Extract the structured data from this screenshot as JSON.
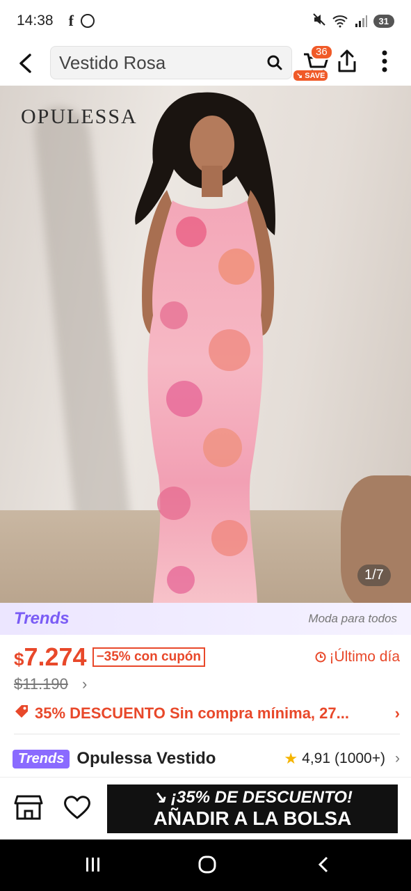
{
  "status_bar": {
    "time": "14:38",
    "battery": "31"
  },
  "header": {
    "search_value": "Vestido Rosa",
    "cart_count": "36",
    "save_label": "SAVE"
  },
  "hero": {
    "brand": "OPULESSA",
    "image_counter": "1/7"
  },
  "trends_strip": {
    "logo": "Trends",
    "tagline": "Moda para todos"
  },
  "price": {
    "currency": "$",
    "amount": "7.274",
    "coupon": "−35% con cupón",
    "last_day": "¡Último día",
    "original": "$11.190"
  },
  "promo": {
    "text": "35% DESCUENTO Sin compra mínima,  27..."
  },
  "product": {
    "badge": "Trends",
    "title": "Opulessa Vestido",
    "rating": "4,91",
    "reviews": "(1000+)"
  },
  "actions": {
    "discount_line": "¡35% DE DESCUENTO!",
    "add_to_bag": "AÑADIR A LA BOLSA"
  },
  "colors": {
    "accent": "#e8482a",
    "trends": "#8a6bff"
  }
}
